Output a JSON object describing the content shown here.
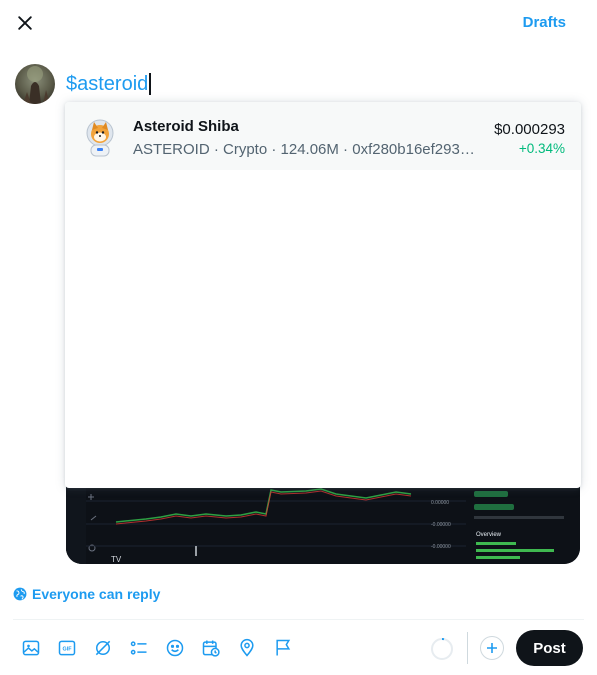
{
  "header": {
    "drafts_label": "Drafts"
  },
  "composer": {
    "text": "$asteroid"
  },
  "typeahead": {
    "results": [
      {
        "name": "Asteroid Shiba",
        "meta": "ASTEROID · Crypto · 124.06M · 0xf280b16ef293d8...",
        "price": "$0.000293",
        "change": "+0.34%"
      }
    ]
  },
  "reply_setting": {
    "label": "Everyone can reply"
  },
  "toolbar": {
    "icons": [
      "image-icon",
      "gif-icon",
      "grok-icon",
      "poll-icon",
      "emoji-icon",
      "schedule-icon",
      "location-icon",
      "flag-icon"
    ]
  },
  "actions": {
    "post_label": "Post"
  },
  "colors": {
    "accent": "#1d9bf0",
    "positive": "#00ba7c",
    "post_bg": "#0f1419"
  }
}
